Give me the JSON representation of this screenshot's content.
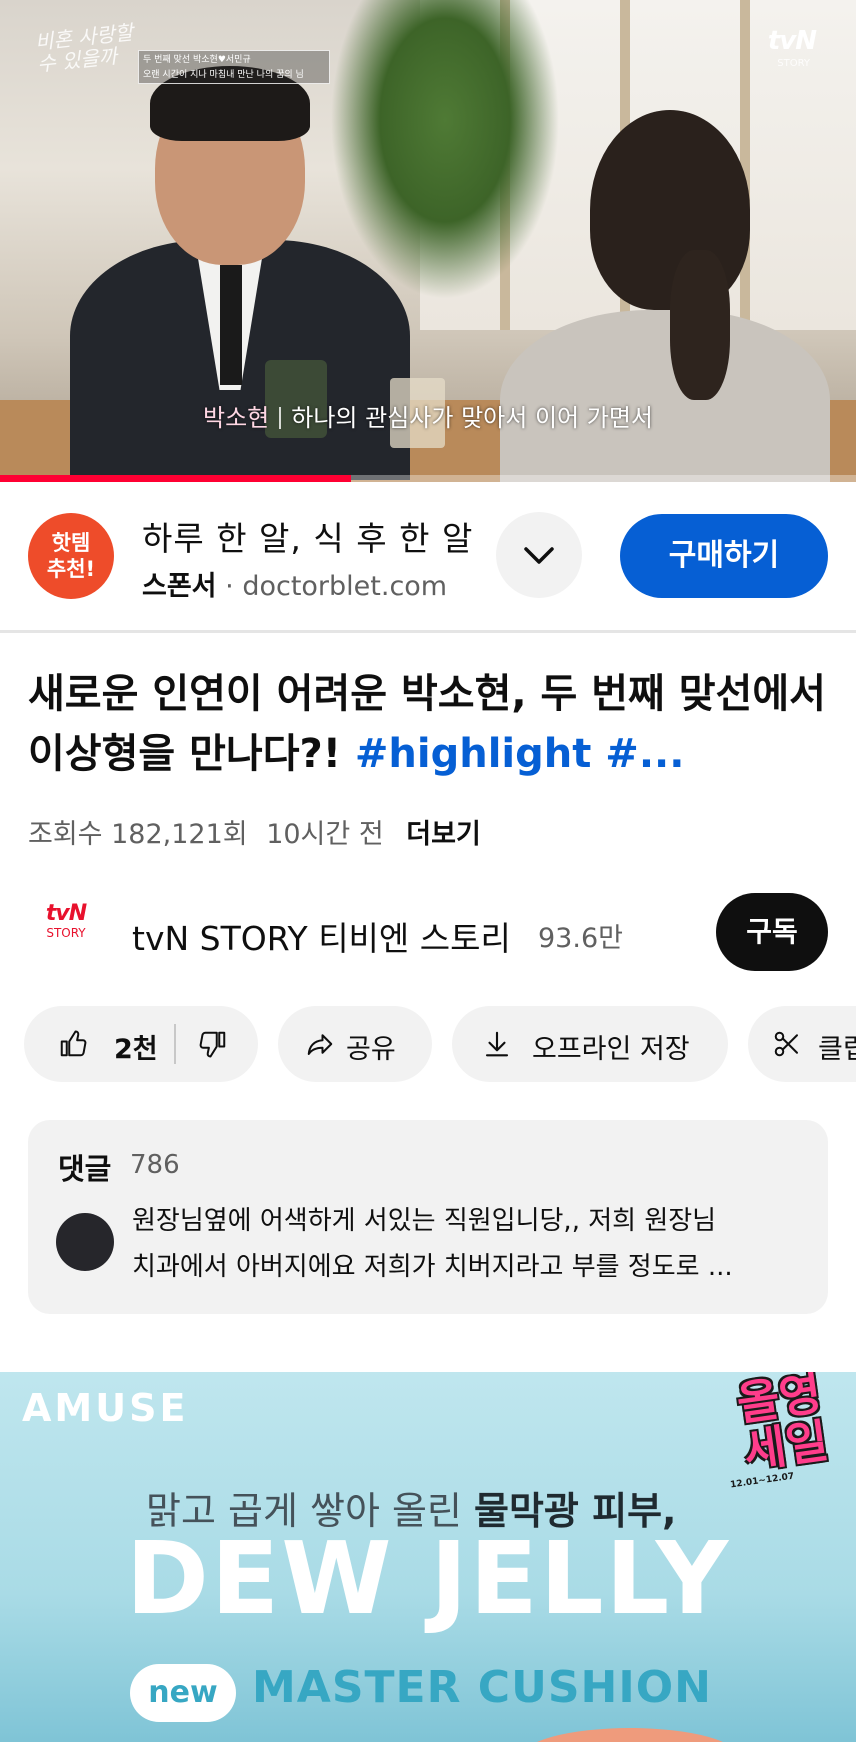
{
  "player": {
    "overlay_logo_left": "비혼 사랑할 수 있을까",
    "caption_box_line1": "두 번째 맞선 박소현♥서민규",
    "caption_box_line2": "오랜 시간이 지나 마침내 만난 나의 꿈의 님",
    "channel_logo": "tvN",
    "channel_logo_sub": "STORY",
    "subtitle_speaker": "박소현",
    "subtitle_text": "하나의 관심사가 맞아서 이어 가면서",
    "progress_fraction": 0.41,
    "progress_color": "#ff0033"
  },
  "sponsor": {
    "badge_line1": "핫템",
    "badge_line2": "추천!",
    "title": "하루 한 알, 식 후 한 알",
    "label": "스폰서",
    "dot": "·",
    "domain": "doctorblet.com",
    "expand_icon": "chevron-down-icon",
    "buy_label": "구매하기",
    "accent_color": "#065fd4"
  },
  "video": {
    "title": "새로운 인연이 어려운 박소현, 두 번째 맞선에서 이상형을 만나다?! ",
    "hashtags": "#highlight #...",
    "views": "조회수 182,121회",
    "age": "10시간 전",
    "more_label": "더보기"
  },
  "channel": {
    "logo_top": "tvN",
    "logo_bottom": "STORY",
    "name": "tvN STORY 티비엔 스토리",
    "subscribers": "93.6만",
    "subscribe_label": "구독"
  },
  "actions": {
    "like_count": "2천",
    "share_label": "공유",
    "download_label": "오프라인 저장",
    "clip_label": "클립",
    "icons": [
      "thumbs-up-icon",
      "thumbs-down-icon",
      "share-icon",
      "download-icon",
      "scissors-icon"
    ]
  },
  "comments": {
    "header": "댓글",
    "count": "786",
    "line1": "원장님옆에 어색하게 서있는 직원입니당,, 저희 원장님",
    "line2": "치과에서 아버지에요 저희가 치버지라고 부를 정도로 ..."
  },
  "ad": {
    "brand": "AMUSE",
    "tagline_prefix": "맑고 곱게 쌓아 올린 ",
    "tagline_bold": "물막광 피부,",
    "sale_line1": "올영",
    "sale_line2": "세일",
    "sale_dates": "12.01~12.07",
    "headline": "DEW JELLY",
    "new_badge": "new",
    "product": "MASTER CUSHION"
  }
}
